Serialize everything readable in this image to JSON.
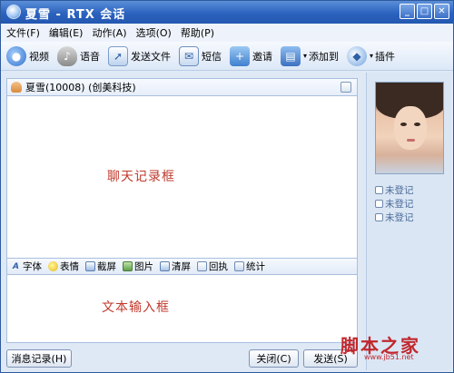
{
  "window": {
    "title": "夏雪 - RTX 会话",
    "controls": {
      "minimize": "_",
      "maximize": "□",
      "close": "✕"
    }
  },
  "menu": [
    "文件(F)",
    "编辑(E)",
    "动作(A)",
    "选项(O)",
    "帮助(P)"
  ],
  "toolbar": {
    "video": "视频",
    "voice": "语音",
    "send_file": "发送文件",
    "sms": "短信",
    "invite": "邀请",
    "add_to": "添加到",
    "plugin": "插件"
  },
  "contact": {
    "name": "夏雪(10008) (创美科技)"
  },
  "chat_area": {
    "label": "聊天记录框"
  },
  "format_bar": {
    "font": "字体",
    "emoji": "表情",
    "screenshot": "截屏",
    "picture": "图片",
    "clear_screen": "清屏",
    "receipt": "回执",
    "stats": "统计"
  },
  "input_area": {
    "label": "文本输入框"
  },
  "buttons": {
    "history": "消息记录(H)",
    "close": "关闭(C)",
    "send": "发送(S)"
  },
  "profile": {
    "statuses": [
      "未登记",
      "未登记",
      "未登记"
    ]
  },
  "watermark": {
    "title": "脚本之家",
    "url": "www.jb51.net"
  },
  "colors": {
    "titlebar": "#2b63bf",
    "accent_red": "#c0392b",
    "panel": "#dbe6f4"
  }
}
